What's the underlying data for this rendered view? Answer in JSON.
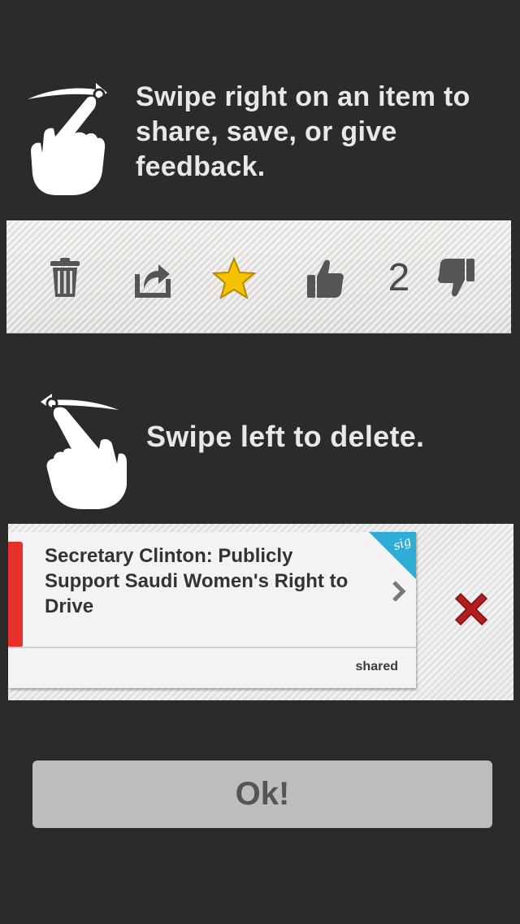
{
  "instructions": {
    "swipe_right": "Swipe right on an item to share, save, or give feedback.",
    "swipe_left": "Swipe left to delete."
  },
  "action_bar": {
    "icons": [
      "trash-icon",
      "share-icon",
      "star-icon",
      "thumbs-up-icon",
      "thumbs-down-icon"
    ],
    "like_count": "2",
    "star_color": "#f5c200"
  },
  "item_card": {
    "title": "Secretary Clinton: Publicly Support Saudi Women's Right to Drive",
    "corner_badge": "sig",
    "footer_label": "shared",
    "accent_color": "#e8302a",
    "corner_color": "#2eaed6",
    "delete_color": "#b31d1d"
  },
  "ok_button": {
    "label": "Ok!"
  }
}
